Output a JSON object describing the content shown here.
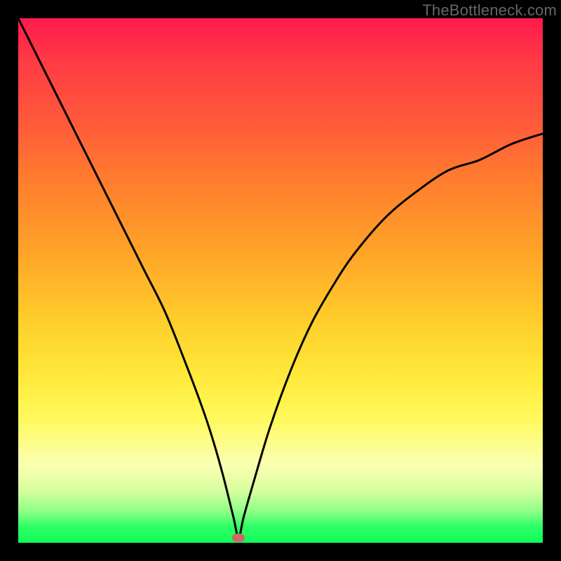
{
  "attribution": "TheBottleneck.com",
  "colors": {
    "frame": "#000000",
    "curve": "#000000",
    "marker": "#c96b62",
    "gradient_top": "#ff1a4d",
    "gradient_bottom": "#10ff58"
  },
  "chart_data": {
    "type": "line",
    "title": "",
    "xlabel": "",
    "ylabel": "",
    "xlim": [
      0,
      100
    ],
    "ylim": [
      0,
      100
    ],
    "grid": false,
    "legend": false,
    "notes": "V-shaped bottleneck curve on rainbow gradient. No visible axis ticks or numeric labels in image; values are estimated from pixel positions on a 0–100 normalized scale.",
    "minimum": {
      "x": 42,
      "y": 1
    },
    "series": [
      {
        "name": "bottleneck-curve",
        "x": [
          0,
          4,
          8,
          12,
          16,
          20,
          24,
          28,
          32,
          35,
          37,
          39,
          41,
          42,
          43,
          45,
          48,
          52,
          56,
          60,
          64,
          70,
          76,
          82,
          88,
          94,
          100
        ],
        "values": [
          100,
          92,
          84,
          76,
          68,
          60,
          52,
          44,
          34,
          26,
          20,
          13,
          5,
          1,
          5,
          12,
          22,
          33,
          42,
          49,
          55,
          62,
          67,
          71,
          73,
          76,
          78
        ]
      }
    ],
    "marker_points": [
      {
        "name": "result-marker",
        "x": 42,
        "y": 1
      }
    ]
  }
}
